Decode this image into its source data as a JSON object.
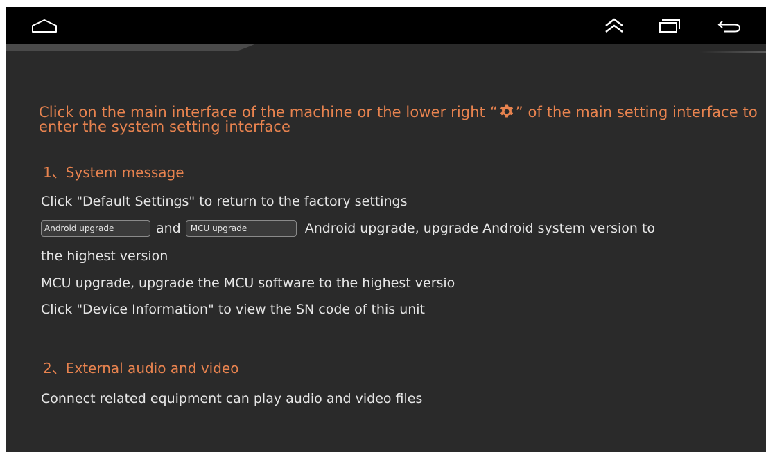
{
  "navbar": {
    "home_icon": "home-outline-icon",
    "up_icon": "double-chevron-up-icon",
    "recent_icon": "recent-apps-icon",
    "back_icon": "back-arrow-icon"
  },
  "colors": {
    "background": "#2a2a2a",
    "navbar": "#000000",
    "accent": "#e8834f",
    "text": "#e6e6e6"
  },
  "intro": {
    "before_icon": "Click on the main interface of the machine or the lower right “",
    "icon": "gear-icon",
    "after_icon": "” of the main setting interface to enter the system setting interface"
  },
  "section1": {
    "heading": "1、System message",
    "line1": "Click \"Default Settings\" to return to the factory settings",
    "android_chip": "Android upgrade",
    "and_text": "and",
    "mcu_chip": "MCU upgrade",
    "line2_tail": "Android upgrade, upgrade Android system version to",
    "line3": "the highest version",
    "line4": "MCU upgrade, upgrade the MCU software to the highest versio",
    "line5": "Click \"Device Information\" to view the SN code of this unit"
  },
  "section2": {
    "heading": "2、External audio and video",
    "line1": "Connect related equipment can play audio and video files"
  }
}
